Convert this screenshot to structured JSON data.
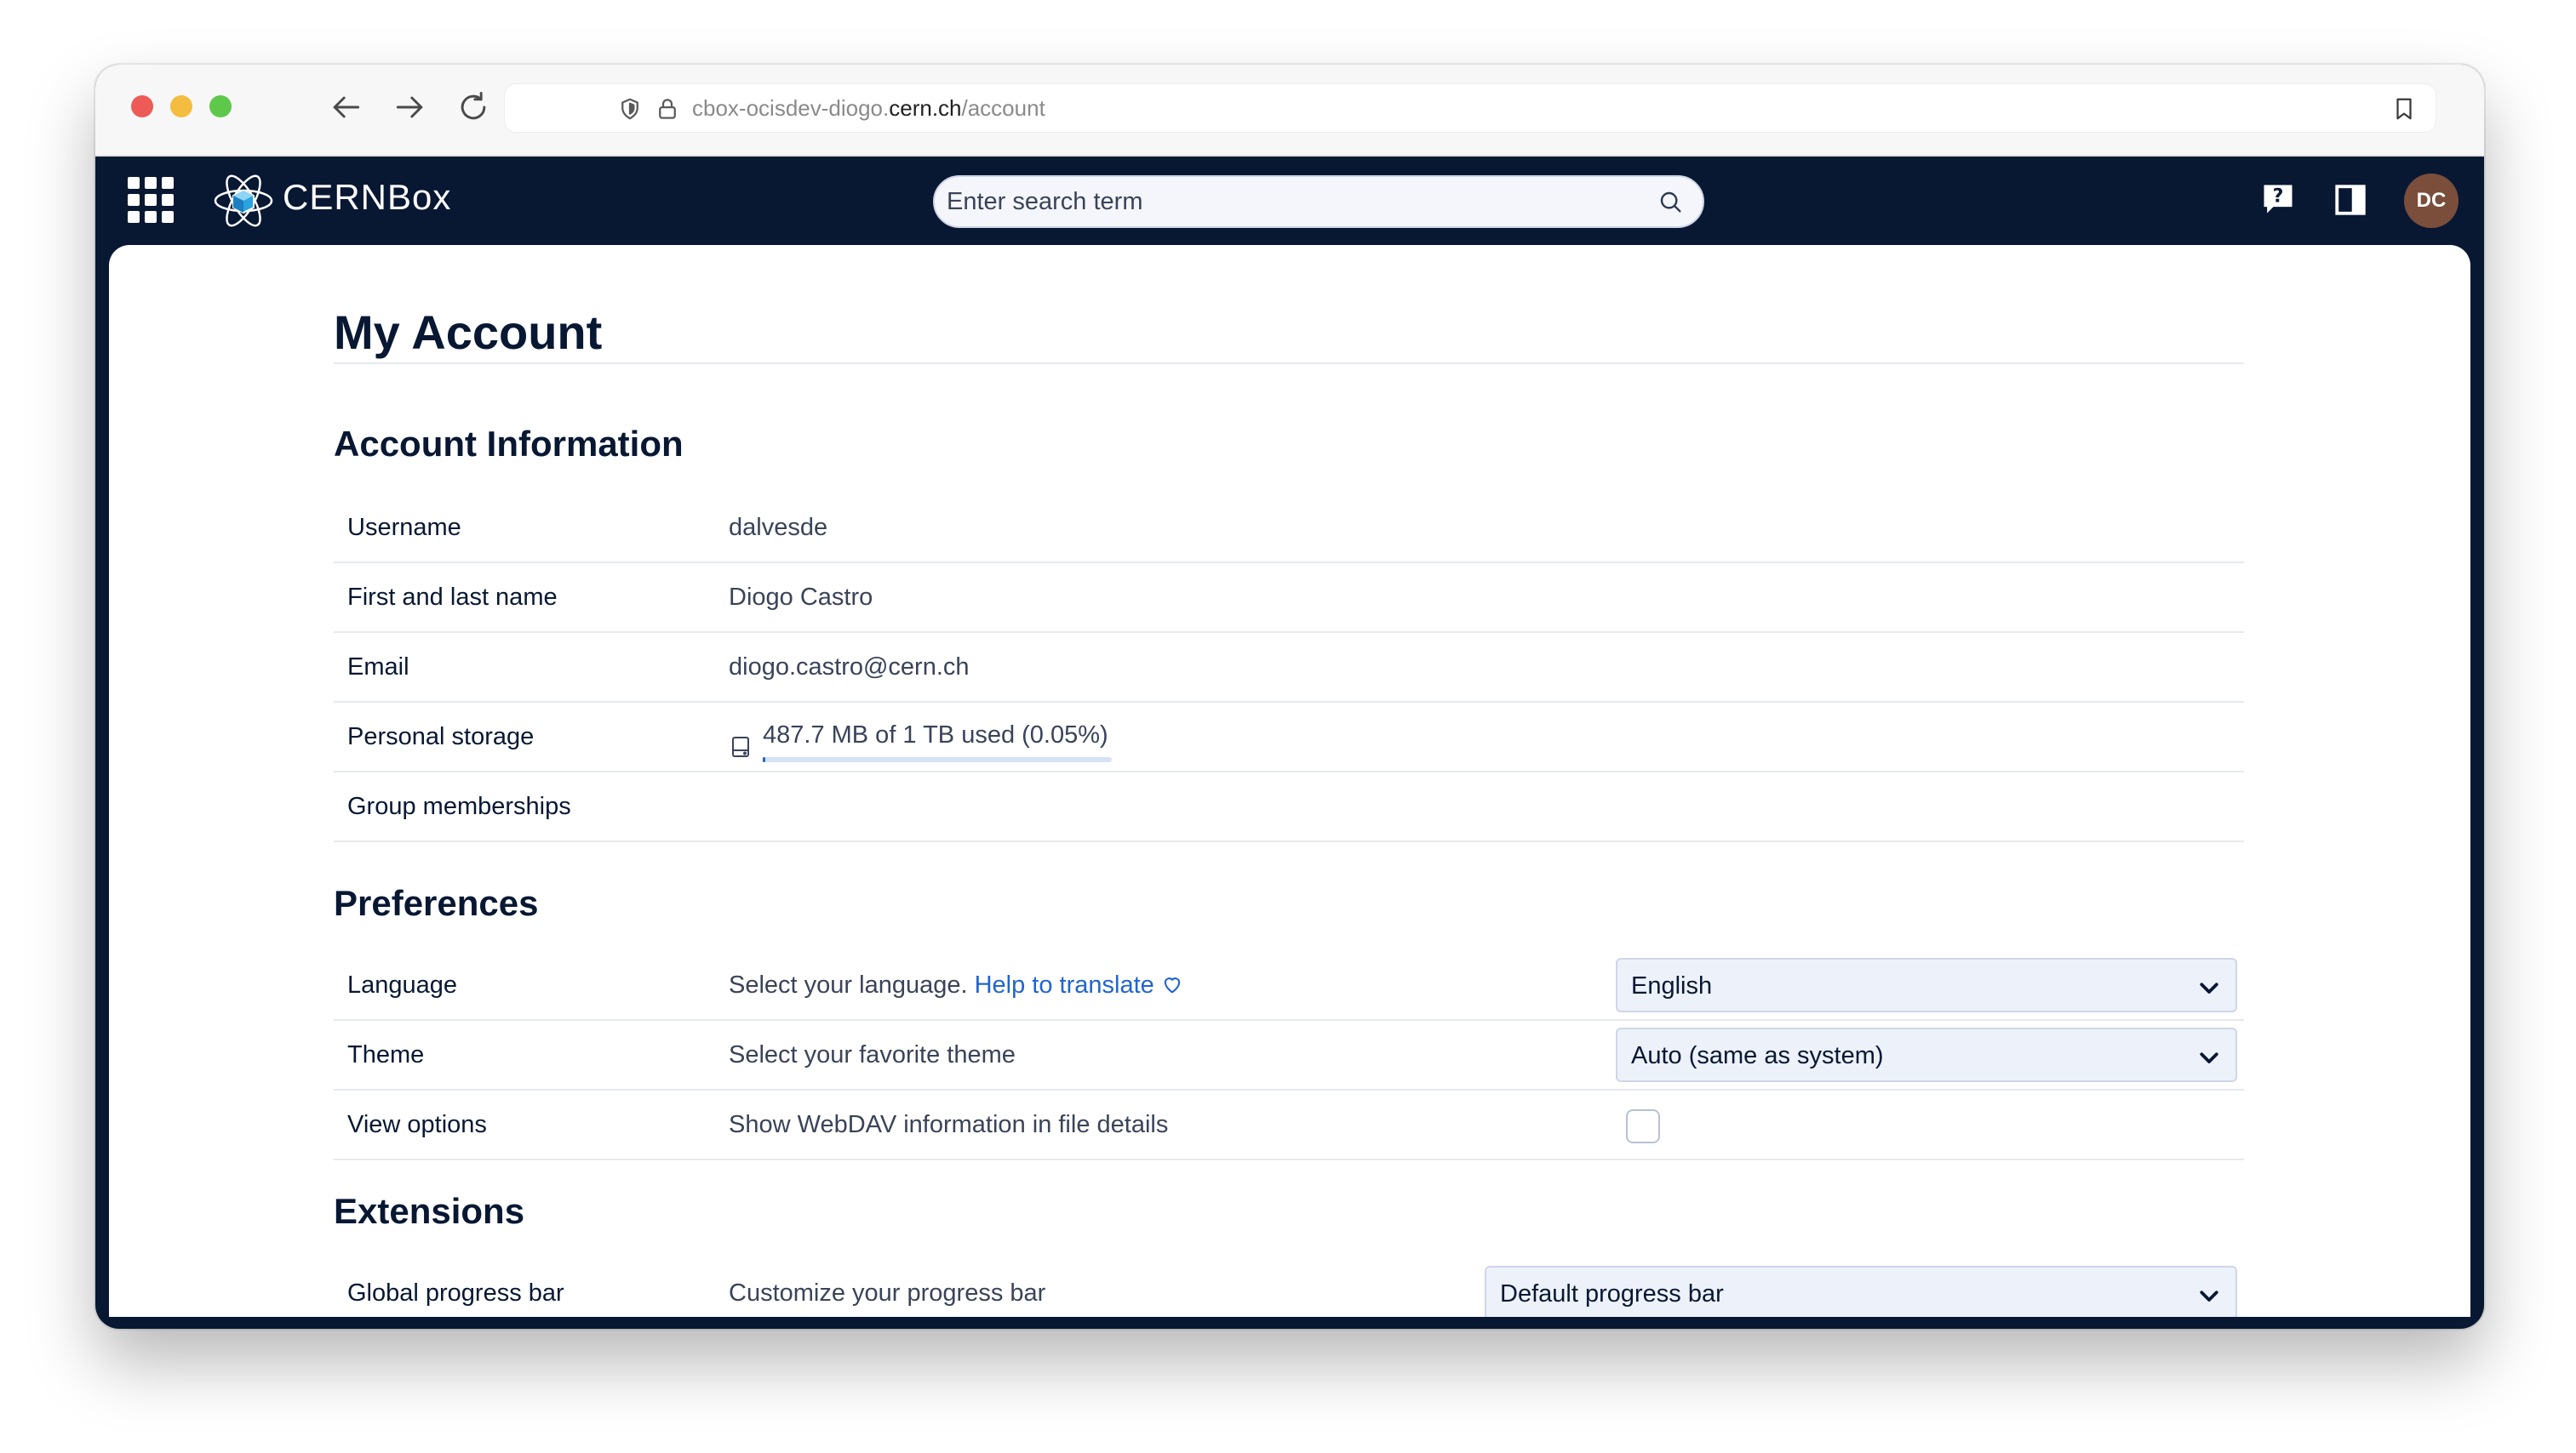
{
  "browser": {
    "url_prefix": "cbox-ocisdev-diogo.",
    "url_host": "cern.ch",
    "url_path": "/account"
  },
  "topbar": {
    "brand_part1": "CERN",
    "brand_part2": "Box",
    "search_placeholder": "Enter search term",
    "avatar_initials": "DC"
  },
  "page": {
    "title": "My Account"
  },
  "account": {
    "heading": "Account Information",
    "rows": [
      {
        "label": "Username",
        "value": "dalvesde"
      },
      {
        "label": "First and last name",
        "value": "Diogo Castro"
      },
      {
        "label": "Email",
        "value": "diogo.castro@cern.ch"
      },
      {
        "label": "Personal storage",
        "value": "487.7 MB of 1 TB used (0.05%)",
        "fraction": 0.0005
      },
      {
        "label": "Group memberships",
        "value": ""
      }
    ]
  },
  "preferences": {
    "heading": "Preferences",
    "language": {
      "label": "Language",
      "description": "Select your language.",
      "help_link": "Help to translate",
      "selected": "English"
    },
    "theme": {
      "label": "Theme",
      "description": "Select your favorite theme",
      "selected": "Auto (same as system)"
    },
    "view_options": {
      "label": "View options",
      "description": "Show WebDAV information in file details",
      "checked": false
    }
  },
  "extensions": {
    "heading": "Extensions",
    "progress_bar": {
      "label": "Global progress bar",
      "description": "Customize your progress bar",
      "selected": "Default progress bar"
    }
  },
  "colors": {
    "topbar_bg": "#081833",
    "link": "#2164d1",
    "avatar_bg": "#7a4e3a"
  }
}
